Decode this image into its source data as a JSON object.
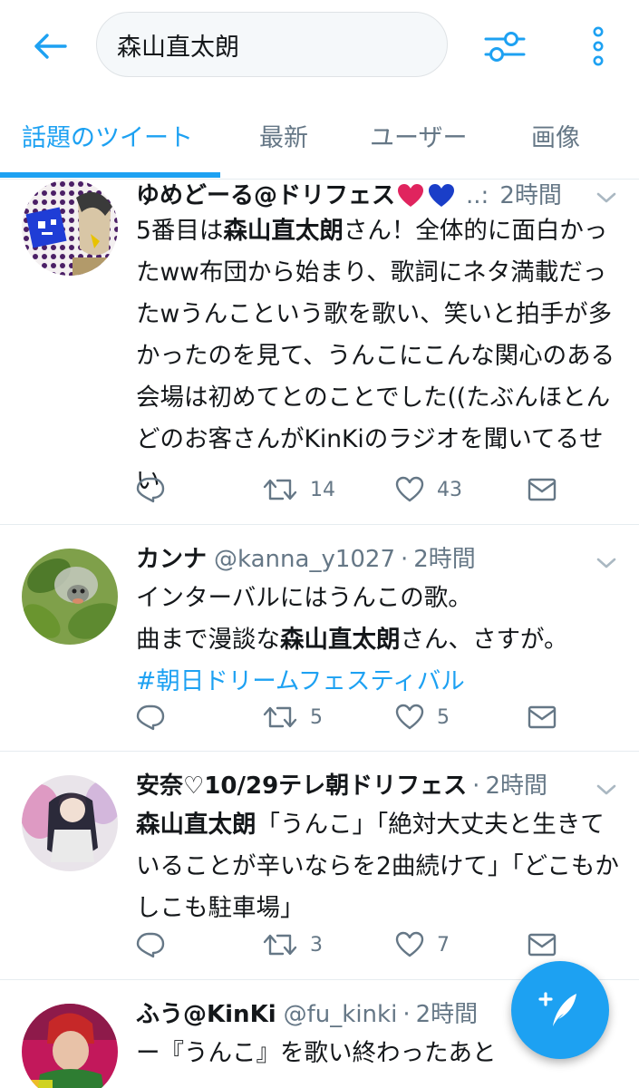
{
  "search": {
    "query": "森山直太朗"
  },
  "tabs": [
    {
      "label": "話題のツイート"
    },
    {
      "label": "最新"
    },
    {
      "label": "ユーザー"
    },
    {
      "label": "画像"
    }
  ],
  "colors": {
    "accent": "#1da1f2",
    "text": "#14171a",
    "muted": "#657786",
    "heart_red": "#e0245e",
    "heart_blue": "#1a3ec8"
  },
  "tweets": [
    {
      "name": "ゆめどーる@ドリフェス",
      "name_emoji": [
        "red-heart",
        "blue-heart"
      ],
      "handle": "..:",
      "separator": "",
      "time": "2時間",
      "text": [
        {
          "t": "5番目は"
        },
        {
          "t": "森山直太朗",
          "bold": true
        },
        {
          "t": "さん！全体的に面白かったww布団から始まり、歌詞にネタ満載だったwうんこという歌を歌い、笑いと拍手が多かったのを見て、うんこにこんな関心のある会場は初めてとのことでした((たぶんほとんどのお客さんがKinKiのラジオを聞いてるせい"
        }
      ],
      "replies": "",
      "retweets": "14",
      "likes": "43"
    },
    {
      "name": "カンナ",
      "handle": "@kanna_y1027",
      "separator": "·",
      "time": "2時間",
      "text": [
        {
          "t": "インターバルにはうんこの歌。"
        },
        {
          "br": true
        },
        {
          "t": "曲まで漫談な"
        },
        {
          "t": "森山直太朗",
          "bold": true
        },
        {
          "t": "さん、さすが。"
        },
        {
          "br": true
        },
        {
          "t": "#朝日ドリームフェスティバル",
          "hashtag": true
        }
      ],
      "replies": "",
      "retweets": "5",
      "likes": "5"
    },
    {
      "name": "安奈♡10/29テレ朝ドリフェス",
      "handle": "",
      "separator": "·",
      "time": "2時間",
      "text": [
        {
          "t": "森山直太朗",
          "bold": true
        },
        {
          "t": "「うんこ」「絶対大丈夫と生きていることが辛いならを2曲続けて」「どこもかしこも駐車場」"
        }
      ],
      "replies": "",
      "retweets": "3",
      "likes": "7"
    },
    {
      "name": "ふう@KinKi",
      "handle": "@fu_kinki",
      "separator": "·",
      "time": "2時間",
      "text": [
        {
          "t": "ー『うんこ』を歌い終わったあと"
        }
      ]
    }
  ],
  "icons": {
    "back": "arrow-left-icon",
    "filter": "sliders-icon",
    "more": "vertical-dots-icon",
    "reply": "reply-icon",
    "retweet": "retweet-icon",
    "like": "heart-icon",
    "dm": "envelope-icon",
    "compose": "compose-feather-icon"
  }
}
